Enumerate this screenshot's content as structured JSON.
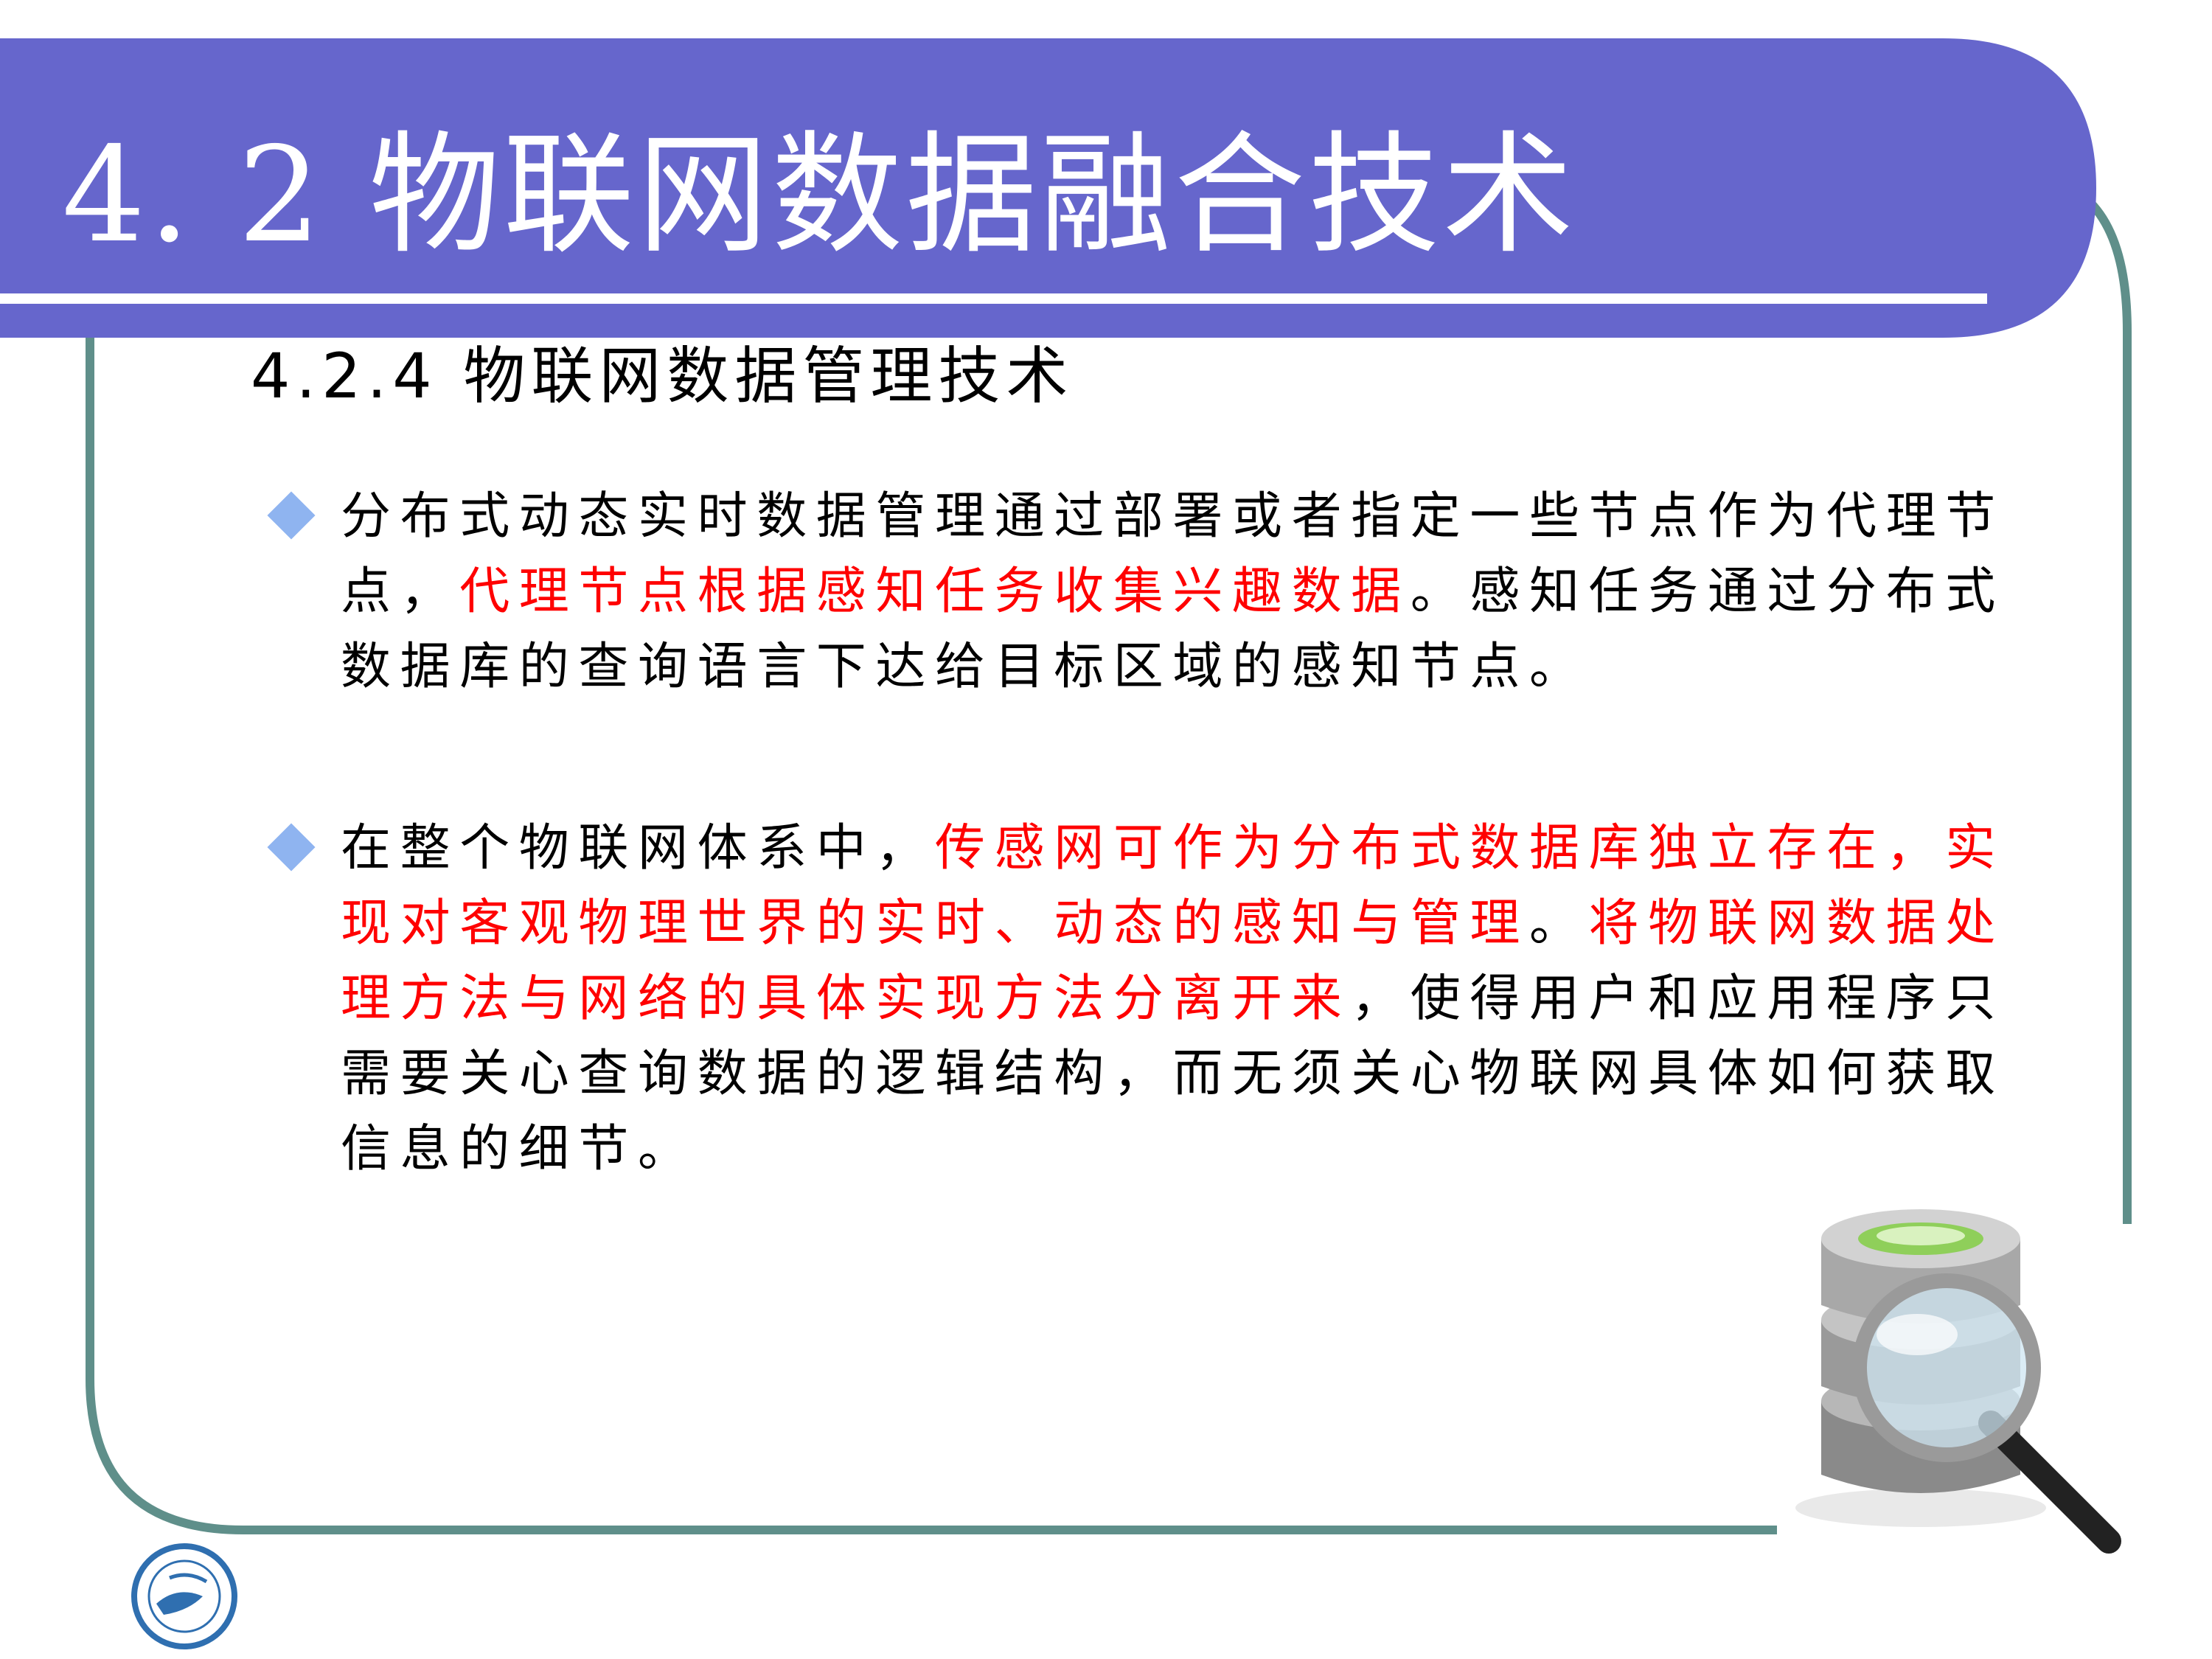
{
  "slide": {
    "title": "4. 2  物联网数据融合技术",
    "subtitle": "4.2.4 物联网数据管理技术"
  },
  "bullets": [
    {
      "segments": [
        {
          "text": "分布式动态实时数据管理通过部署或者指定一些节点作为代理节点，",
          "color": "black"
        },
        {
          "text": "代理节点根据感知任务收集兴趣数据",
          "color": "red"
        },
        {
          "text": "。感知任务通过分布式数据库的查询语言下达给目标区域的感知节点。",
          "color": "black"
        }
      ]
    },
    {
      "segments": [
        {
          "text": "在整个物联网体系中，",
          "color": "black"
        },
        {
          "text": "传感网可作为分布式数据库独立存在，实现对客观物理世界的实时、动态的感知与管理",
          "color": "red"
        },
        {
          "text": "。",
          "color": "black"
        },
        {
          "text": "将物联网数据处理方法与网络的具体实现方法分离开来",
          "color": "red"
        },
        {
          "text": "，使得用户和应用程序只需要关心查询数据的逻辑结构，而无须关心物联网具体如何获取信息的细节。",
          "color": "black"
        }
      ]
    }
  ],
  "colors": {
    "banner": "#6666cc",
    "frame": "#5f8f8a",
    "highlight": "#ff0000",
    "bullet": "#8fb4f0"
  },
  "icons": {
    "clipart": "database-magnifier-icon",
    "logo": "university-logo"
  }
}
